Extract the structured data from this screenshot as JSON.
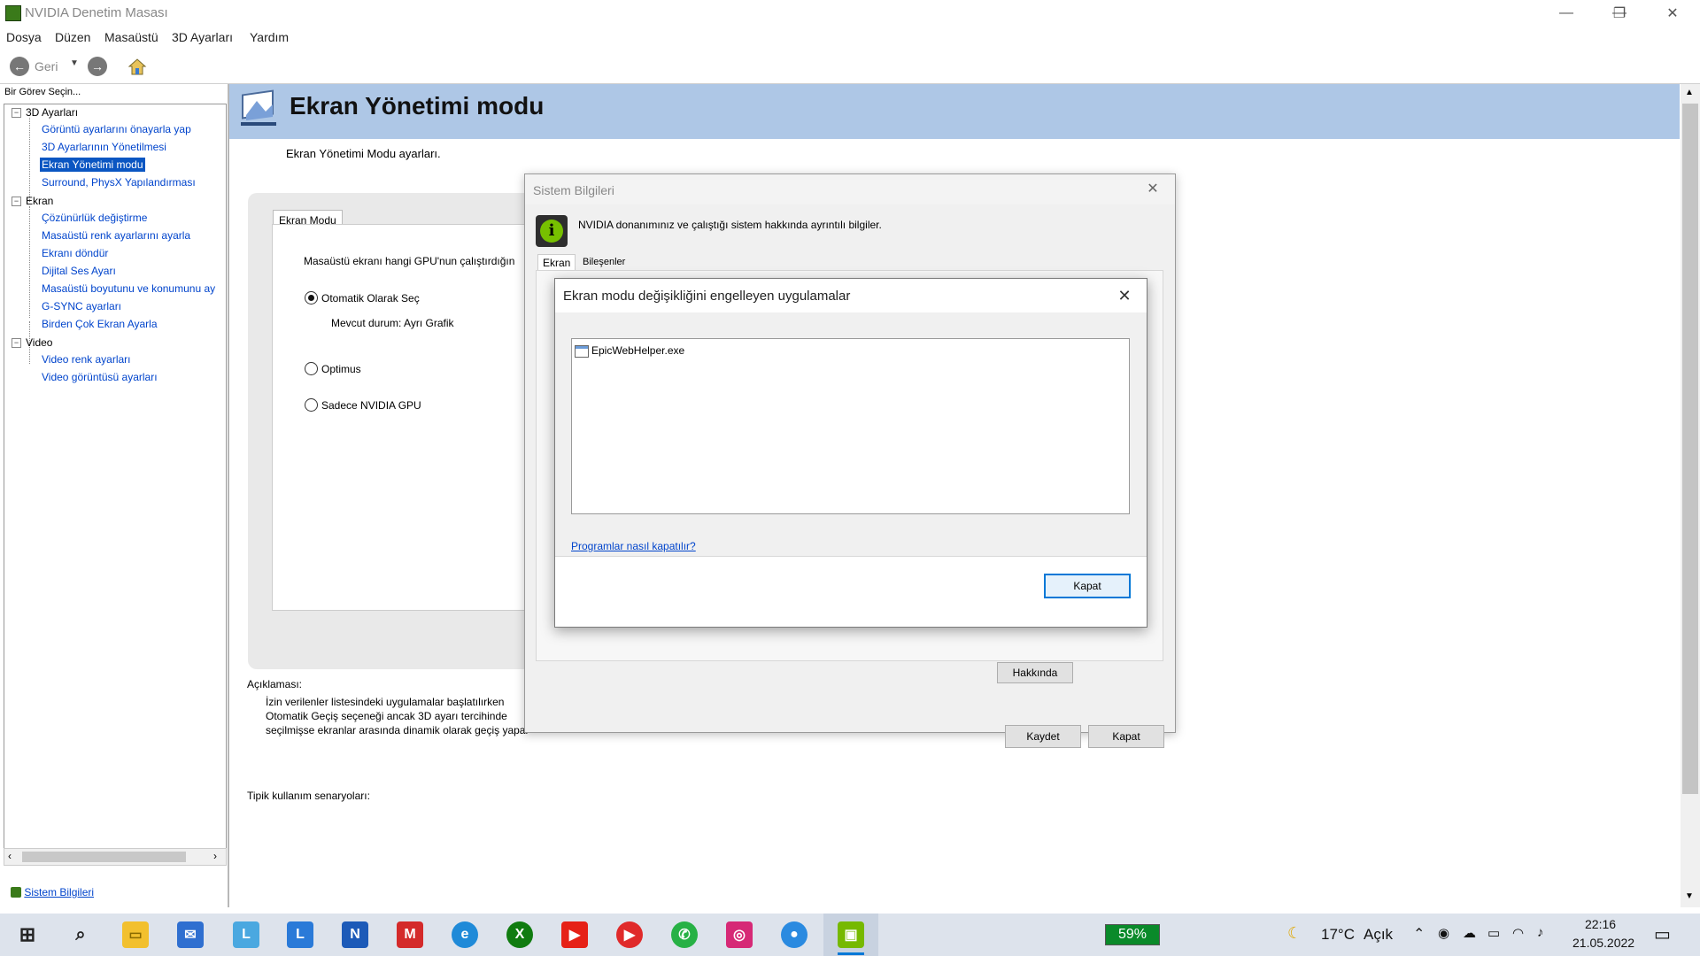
{
  "window": {
    "title": "NVIDIA Denetim Masası",
    "min": "—",
    "restore": "❐",
    "close": "✕"
  },
  "menu": [
    "Dosya",
    "Düzen",
    "Masaüstü",
    "3D Ayarları",
    "Yardım"
  ],
  "toolbar": {
    "back_label": "Geri"
  },
  "left": {
    "header": "Bir Görev Seçin...",
    "tree": {
      "cat1": "3D Ayarları",
      "cat1_items": [
        "Görüntü ayarlarını önayarla yap",
        "3D Ayarlarının Yönetilmesi",
        "Ekran Yönetimi modu",
        "Surround, PhysX Yapılandırması"
      ],
      "cat2": "Ekran",
      "cat2_items": [
        "Çözünürlük değiştirme",
        "Masaüstü renk ayarlarını ayarla",
        "Ekranı döndür",
        "Dijital Ses Ayarı",
        "Masaüstü boyutunu ve konumunu ay",
        "G-SYNC ayarları",
        "Birden Çok Ekran Ayarla"
      ],
      "cat3": "Video",
      "cat3_items": [
        "Video renk ayarları",
        "Video görüntüsü ayarları"
      ],
      "expander": "−"
    },
    "sysinfo_link": "Sistem Bilgileri"
  },
  "main": {
    "title": "Ekran Yönetimi modu",
    "subtitle": "Ekran Yönetimi Modu ayarları.",
    "tab": "Ekran Modu",
    "question": "Masaüstü ekranı hangi GPU'nun çalıştırdığın",
    "options": [
      "Otomatik Olarak Seç",
      "Optimus",
      "Sadece NVIDIA GPU"
    ],
    "current_status": "Mevcut durum: Ayrı Grafik",
    "desc_heading": "Açıklaması:",
    "desc_lines": [
      "İzin verilenler listesindeki uygulamalar başlatılırken",
      "Otomatik Geçiş seçeneği ancak 3D ayarı tercihinde",
      "seçilmişse ekranlar arasında dinamik olarak geçiş yapar"
    ],
    "usage_heading": "Tipik kullanım senaryoları:"
  },
  "dialog_sysinfo": {
    "title": "Sistem Bilgileri",
    "close": "✕",
    "description": "NVIDIA donanımınız ve çalıştığı sistem hakkında ayrıntılı bilgiler.",
    "tabs": [
      "Ekran",
      "Bileşenler"
    ],
    "about_button": "Hakkında",
    "save_button": "Kaydet",
    "close_button": "Kapat"
  },
  "dialog_apps": {
    "title": "Ekran modu değişikliğini engelleyen uygulamalar",
    "close": "✕",
    "apps": [
      "EpicWebHelper.exe"
    ],
    "help_link": "Programlar nasıl kapatılır?",
    "close_button": "Kapat"
  },
  "taskbar": {
    "battery": "59%",
    "weather_temp": "17°C",
    "weather_desc": "Açık",
    "time": "22:16",
    "date": "21.05.2022"
  },
  "colors": {
    "selection": "#0a56c2",
    "header_band": "#aec7e6",
    "nvidia_green": "#76b900",
    "link": "#0044cc"
  }
}
